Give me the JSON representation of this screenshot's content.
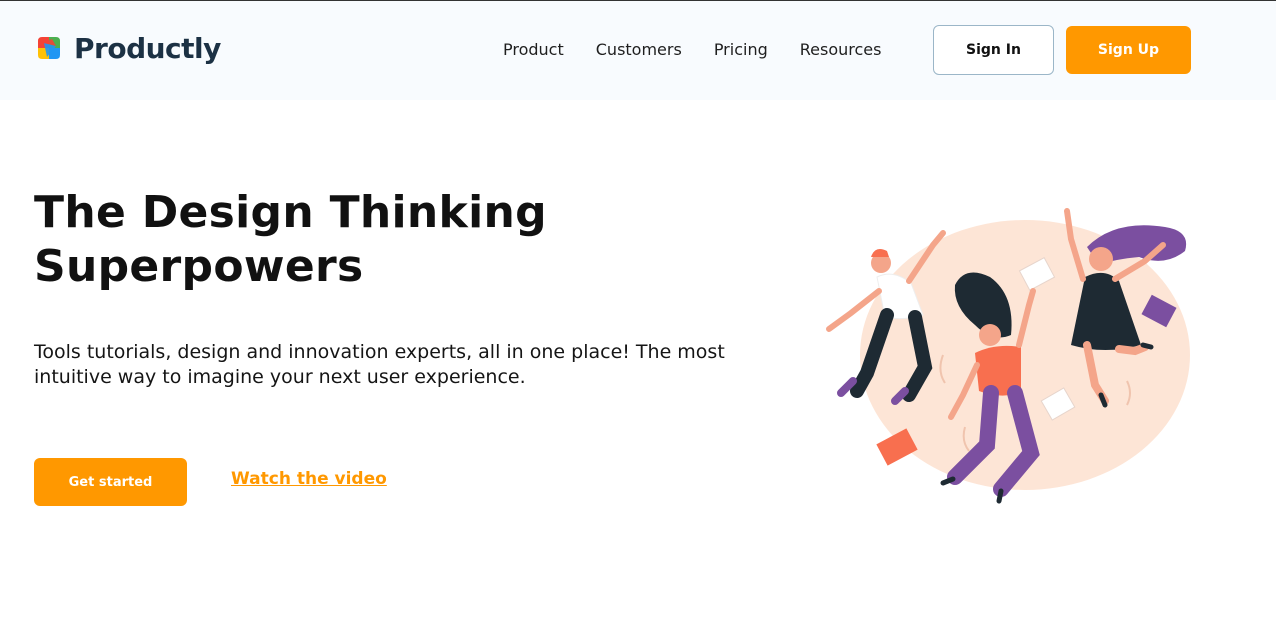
{
  "brand": {
    "name": "Productly",
    "colors": {
      "red": "#f44336",
      "yellow": "#ffc107",
      "blue": "#2196f3",
      "green": "#4caf50",
      "text": "#1c3144"
    }
  },
  "nav": {
    "items": [
      {
        "label": "Product"
      },
      {
        "label": "Customers"
      },
      {
        "label": "Pricing"
      },
      {
        "label": "Resources"
      }
    ],
    "signin_label": "Sign In",
    "signup_label": "Sign Up"
  },
  "hero": {
    "title_line1": "The Design Thinking",
    "title_line2": "Superpowers",
    "subtitle": "Tools tutorials, design and innovation experts, all in one place! The most intuitive way to imagine your next user experience.",
    "cta_primary": "Get started",
    "cta_secondary": "Watch the video",
    "illustration_icon": "jumping-people-illustration"
  },
  "theme": {
    "accent": "#ff9800",
    "header_bg": "#f8fbfe",
    "blob": "#fde5d6",
    "purple": "#7b4fa0",
    "coral": "#f86f4f",
    "dark": "#1e2a33"
  }
}
